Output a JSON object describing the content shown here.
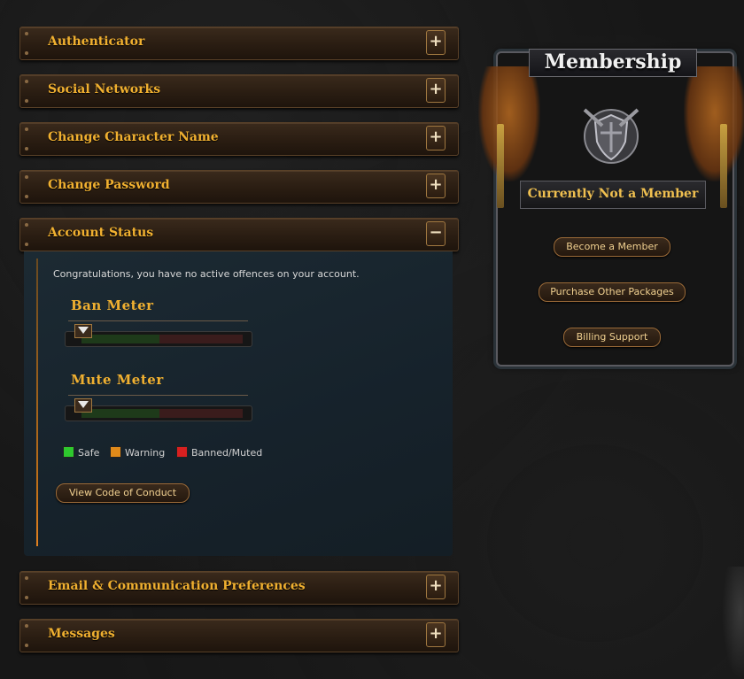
{
  "sections": [
    {
      "label": "Authenticator",
      "toggle": "+"
    },
    {
      "label": "Social Networks",
      "toggle": "+"
    },
    {
      "label": "Change Character Name",
      "toggle": "+"
    },
    {
      "label": "Change Password",
      "toggle": "+"
    },
    {
      "label": "Account Status",
      "toggle": "−"
    },
    {
      "label": "Email & Communication Preferences",
      "toggle": "+"
    },
    {
      "label": "Messages",
      "toggle": "+"
    }
  ],
  "account_status": {
    "message": "Congratulations, you have no active offences on your account.",
    "ban_meter": {
      "title": "Ban Meter",
      "level": 0
    },
    "mute_meter": {
      "title": "Mute Meter",
      "level": 0
    },
    "legend": {
      "safe": "Safe",
      "warning": "Warning",
      "banned": "Banned/Muted"
    },
    "code_button": "View Code of Conduct"
  },
  "membership": {
    "title": "Membership",
    "status": "Currently Not a Member",
    "buttons": {
      "become": "Become a Member",
      "packages": "Purchase Other Packages",
      "billing": "Billing Support"
    }
  },
  "colors": {
    "accent": "#f0b030",
    "safe": "#2ec82e",
    "warning": "#e08a1a",
    "banned": "#d82020"
  }
}
